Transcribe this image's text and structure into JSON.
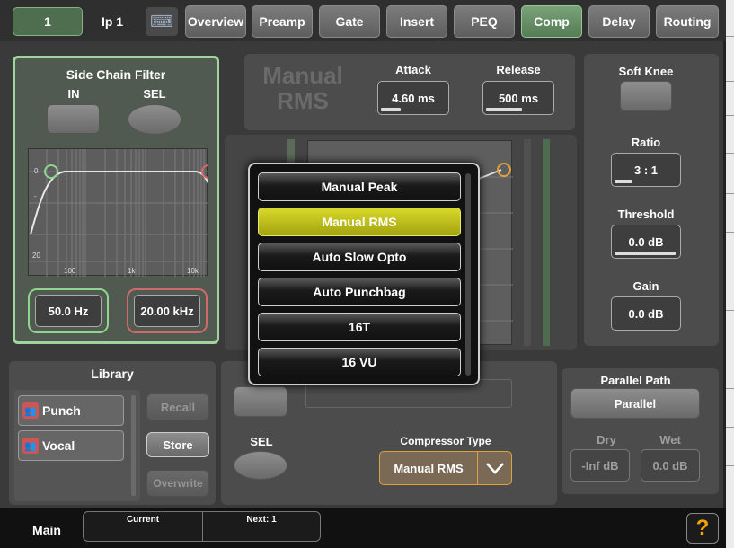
{
  "topbar": {
    "channel_number": "1",
    "channel_name": "Ip 1",
    "tabs": [
      {
        "label": "Overview",
        "active": false
      },
      {
        "label": "Preamp",
        "active": false
      },
      {
        "label": "Gate",
        "active": false
      },
      {
        "label": "Insert",
        "active": false
      },
      {
        "label": "PEQ",
        "active": false
      },
      {
        "label": "Comp",
        "active": true
      },
      {
        "label": "Delay",
        "active": false
      },
      {
        "label": "Routing",
        "active": false
      }
    ]
  },
  "sidechain": {
    "title": "Side Chain Filter",
    "in_label": "IN",
    "sel_label": "SEL",
    "graph_ticks_y": [
      "0",
      "-",
      "20"
    ],
    "graph_ticks_x": [
      "100",
      "1k",
      "10k"
    ],
    "low_value": "50.0 Hz",
    "high_value": "20.00 kHz"
  },
  "comp": {
    "mode_watermark_line1": "Manual",
    "mode_watermark_line2": "RMS",
    "attack_label": "Attack",
    "attack_value": "4.60 ms",
    "release_label": "Release",
    "release_value": "500 ms",
    "soft_knee_label": "Soft Knee",
    "ratio_label": "Ratio",
    "ratio_value": "3 : 1",
    "threshold_label": "Threshold",
    "threshold_value": "0.0 dB",
    "gain_label": "Gain",
    "gain_value": "0.0 dB",
    "sel_label": "SEL",
    "compressor_type_label": "Compressor Type",
    "compressor_type_value": "Manual RMS"
  },
  "library": {
    "title": "Library",
    "items": [
      "Punch",
      "Vocal"
    ],
    "recall_label": "Recall",
    "store_label": "Store",
    "overwrite_label": "Overwrite"
  },
  "parallel": {
    "title": "Parallel Path",
    "button_label": "Parallel",
    "dry_label": "Dry",
    "dry_value": "-Inf dB",
    "wet_label": "Wet",
    "wet_value": "0.0 dB"
  },
  "dropdown": {
    "options": [
      "Manual Peak",
      "Manual RMS",
      "Auto Slow Opto",
      "Auto Punchbag",
      "16T",
      "16 VU"
    ],
    "selected": "Manual RMS"
  },
  "bottombar": {
    "main_label": "Main",
    "current_label": "Current",
    "next_label": "Next: 1",
    "help_label": "?"
  },
  "colors": {
    "active_tab": "#6b936b",
    "highlight_yellow": "#c8c81e",
    "filter_green": "#8fd48f",
    "filter_red": "#d06a6a",
    "orange_accent": "#e0a040"
  }
}
